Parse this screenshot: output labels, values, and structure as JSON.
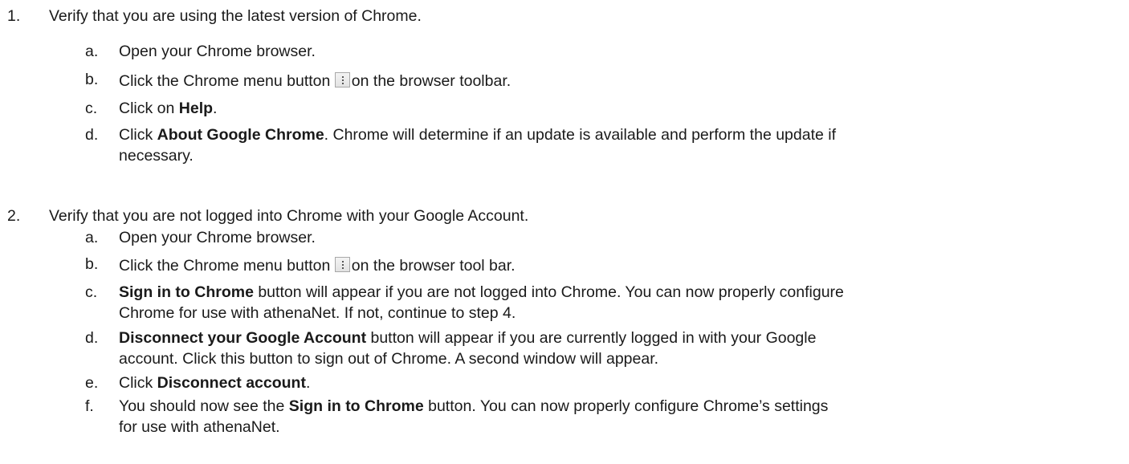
{
  "steps": [
    {
      "number": "1.",
      "text": "Verify that you are using the latest version of Chrome.",
      "substeps": {
        "a": {
          "letter": "a.",
          "text": "Open your Chrome browser."
        },
        "b": {
          "letter": "b.",
          "pre": "Click the Chrome menu button",
          "post": "on the browser toolbar."
        },
        "c": {
          "letter": "c.",
          "pre": "Click on ",
          "bold": "Help",
          "post": "."
        },
        "d": {
          "letter": "d.",
          "pre": "Click ",
          "bold": "About Google Chrome",
          "post": ". Chrome will determine if an update is available and perform the update if",
          "line2": "necessary."
        }
      }
    },
    {
      "number": "2.",
      "text": "Verify that you are not logged into Chrome with your Google Account.",
      "substeps": {
        "a": {
          "letter": "a.",
          "text": "Open your Chrome browser."
        },
        "b": {
          "letter": "b.",
          "pre": "Click the Chrome menu button",
          "post": "on the browser tool bar."
        },
        "c": {
          "letter": "c.",
          "bold": "Sign in to Chrome",
          "post": " button will appear if you are not logged into Chrome. You can now properly configure",
          "line2": "Chrome for use with athenaNet. If not, continue to step 4."
        },
        "d": {
          "letter": "d.",
          "bold": "Disconnect your Google Account",
          "post": " button will appear if you are currently logged in with your Google",
          "line2": "account. Click this button to sign out of Chrome. A second window will appear."
        },
        "e": {
          "letter": "e.",
          "pre": "Click ",
          "bold": "Disconnect account",
          "post": "."
        },
        "f": {
          "letter": "f.",
          "pre": "You should now see the ",
          "bold": "Sign in to Chrome",
          "post": " button. You can now properly configure Chrome’s settings",
          "line2": "for use with athenaNet."
        }
      }
    }
  ],
  "icons": {
    "chrome_menu": "chrome-menu-icon"
  }
}
